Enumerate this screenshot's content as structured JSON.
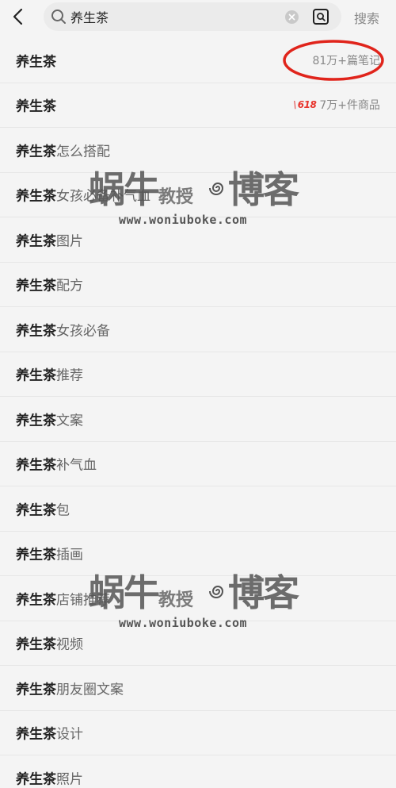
{
  "header": {
    "back_icon": "chevron-left-icon",
    "search": {
      "value": "养生茶",
      "icon": "search-icon",
      "clear_icon": "close-circle-icon",
      "scan_icon": "scan-icon"
    },
    "action_label": "搜索"
  },
  "suggestions": [
    {
      "keyword": "养生茶",
      "suffix": "",
      "meta": "81万+篇笔记"
    },
    {
      "keyword": "养生茶",
      "suffix": "",
      "badge": "618",
      "meta": "7万+件商品"
    },
    {
      "keyword": "养生茶",
      "suffix": "怎么搭配"
    },
    {
      "keyword": "养生茶",
      "suffix": "女孩必备补气血"
    },
    {
      "keyword": "养生茶",
      "suffix": "图片"
    },
    {
      "keyword": "养生茶",
      "suffix": "配方"
    },
    {
      "keyword": "养生茶",
      "suffix": "女孩必备"
    },
    {
      "keyword": "养生茶",
      "suffix": "推荐"
    },
    {
      "keyword": "养生茶",
      "suffix": "文案"
    },
    {
      "keyword": "养生茶",
      "suffix": "补气血"
    },
    {
      "keyword": "养生茶",
      "suffix": "包"
    },
    {
      "keyword": "养生茶",
      "suffix": "插画"
    },
    {
      "keyword": "养生茶",
      "suffix": "店铺推荐"
    },
    {
      "keyword": "养生茶",
      "suffix": "视频"
    },
    {
      "keyword": "养生茶",
      "suffix": "朋友圈文案"
    },
    {
      "keyword": "养生茶",
      "suffix": "设计"
    },
    {
      "keyword": "养生茶",
      "suffix": "照片"
    }
  ],
  "watermark": {
    "part1": "蜗牛",
    "part2": "教授",
    "part3": "博客",
    "url": "www.woniuboke.com"
  },
  "colors": {
    "background": "#f4f4f4",
    "highlight_ring": "#e0241b",
    "badge_red": "#e8342c"
  }
}
